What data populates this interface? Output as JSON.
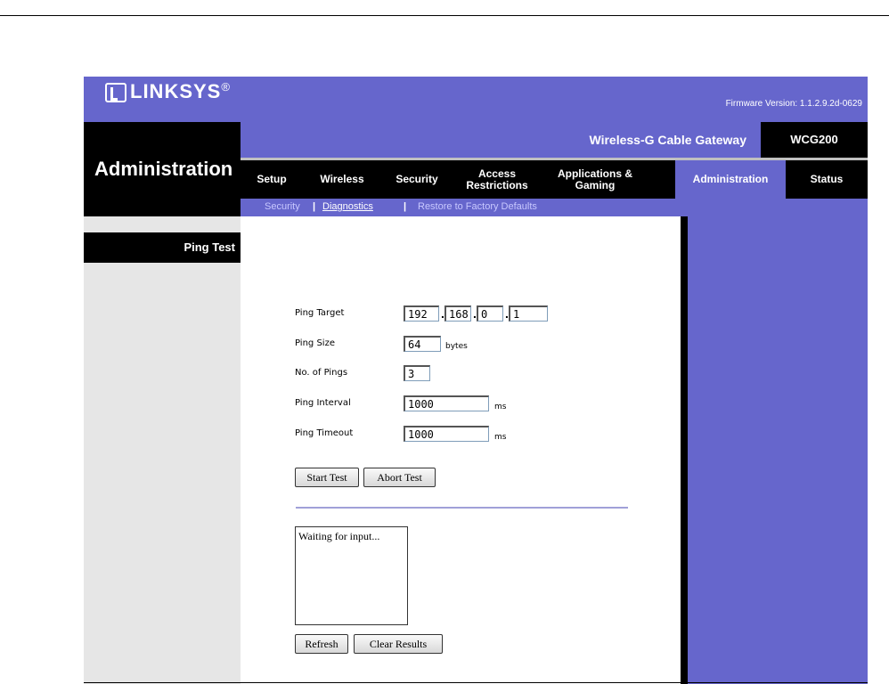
{
  "header": {
    "brand": "LINKSYS",
    "brand_mark": "®",
    "firmware": "Firmware Version: 1.1.2.9.2d-0629",
    "product_name": "Wireless-G Cable Gateway",
    "model": "WCG200",
    "page_title": "Administration"
  },
  "tabs": [
    {
      "label": "Setup"
    },
    {
      "label": "Wireless"
    },
    {
      "label": "Security"
    },
    {
      "label": "Access Restrictions"
    },
    {
      "label": "Applications & Gaming"
    },
    {
      "label": "Administration",
      "active": true
    },
    {
      "label": "Status"
    }
  ],
  "subnav": [
    {
      "label": "Security"
    },
    {
      "label": "Diagnostics",
      "active": true
    },
    {
      "label": "Restore to Factory Defaults"
    }
  ],
  "section_title": "Ping Test",
  "form": {
    "ping_target": {
      "label": "Ping Target",
      "octets": [
        "192",
        "168",
        "0",
        "1"
      ]
    },
    "ping_size": {
      "label": "Ping Size",
      "value": "64",
      "unit": "bytes"
    },
    "num_pings": {
      "label": "No. of Pings",
      "value": "3"
    },
    "ping_interval": {
      "label": "Ping Interval",
      "value": "1000",
      "unit": "ms"
    },
    "ping_timeout": {
      "label": "Ping Timeout",
      "value": "1000",
      "unit": "ms"
    }
  },
  "buttons": {
    "start": "Start Test",
    "abort": "Abort Test",
    "refresh": "Refresh",
    "clear": "Clear Results"
  },
  "results_text": "Waiting for input...",
  "colors": {
    "brand": "#6666cc",
    "band": "#000000",
    "side": "#e6e6e6"
  }
}
